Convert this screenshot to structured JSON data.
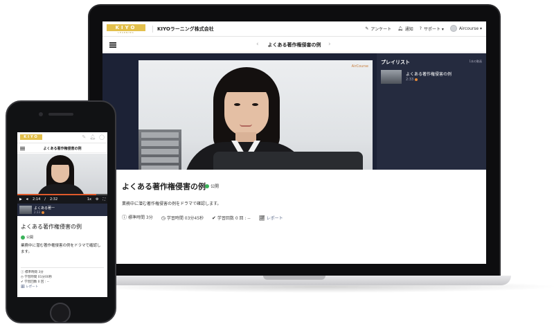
{
  "brand": {
    "logo_text": "KIYO",
    "logo_sub": "LEARNING",
    "org_name": "KIYOラーニング株式会社",
    "accent_color": "#e3c04c"
  },
  "header": {
    "menu": [
      {
        "icon": "edit-icon",
        "label": "アンケート"
      },
      {
        "icon": "bell-icon",
        "label": "通知"
      },
      {
        "icon": "help-icon",
        "label": "サポート ▾"
      },
      {
        "icon": "avatar",
        "label": "Aircourse ▾"
      }
    ]
  },
  "course": {
    "title": "よくある著作権侵害の例",
    "status": "公開",
    "description": "業務中に潜む著作権侵害の例をドラマで確認します。",
    "meta": {
      "standard_time": "標準時間 3分",
      "study_time": "学習時間 03分45秒",
      "study_count": "学習回数 0 回 : --",
      "report": "レポート"
    }
  },
  "player": {
    "watermark": "AirCourse",
    "current_time": "2:14",
    "separator": "/",
    "duration": "2:32",
    "speed": "1x",
    "progress": 0.88
  },
  "playlist": {
    "heading": "プレイリスト",
    "count": "1本の動画",
    "items": [
      {
        "title": "よくある著作権侵害の例",
        "time": "2:33"
      }
    ]
  },
  "phone": {
    "playlist_title": "よくある著一",
    "playlist_time": "2:33",
    "description": "業務中に潜む著作権侵害の例をドラマで確認します。",
    "meta": {
      "standard_time": "標準時間 3分",
      "study_time": "学習時間 01分00秒",
      "study_count": "学習回数 0 回 : --",
      "report": "レポート"
    }
  }
}
